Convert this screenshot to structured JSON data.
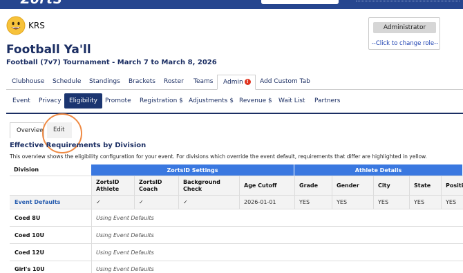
{
  "header": {
    "logo_text": "ZortS"
  },
  "org": {
    "avatar_icon": "smiley-face-icon",
    "name": "KRS"
  },
  "role": {
    "button_label": "Administrator",
    "change_link": "--Click to change role--"
  },
  "event": {
    "title": "Football Ya'll",
    "subtitle": "Football (7v7) Tournament  -  March 7 to March 8, 2026"
  },
  "main_tabs": [
    "Clubhouse",
    "Schedule",
    "Standings",
    "Brackets",
    "Roster",
    "Teams",
    "Admin",
    "Add Custom Tab"
  ],
  "admin_alert": "!",
  "admin_tabs": [
    "Event",
    "Privacy",
    "Eligibility",
    "Promote",
    "Registration $",
    "Adjustments $",
    "Revenue $",
    "Wait List",
    "Partners"
  ],
  "sub_tabs": [
    "Overview",
    "Edit"
  ],
  "section": {
    "title": "Effective Requirements by Division",
    "description": "This overview shows the eligibility configuration for your event. For divisions which override the event default, requirements that differ are highlighted in yellow."
  },
  "table": {
    "division_header": "Division",
    "group_headers": [
      "ZortsID Settings",
      "Athlete Details"
    ],
    "columns": [
      "ZortsID Athlete",
      "ZortsID Coach",
      "Background Check",
      "Age Cutoff",
      "Grade",
      "Gender",
      "City",
      "State",
      "Position"
    ],
    "defaults_row": {
      "label": "Event Defaults",
      "values": [
        "✓",
        "✓",
        "✓",
        "2026-01-01",
        "YES",
        "YES",
        "YES",
        "YES",
        "YES"
      ]
    },
    "divisions": [
      {
        "label": "Coed 8U",
        "note": "Using Event Defaults"
      },
      {
        "label": "Coed 10U",
        "note": "Using Event Defaults"
      },
      {
        "label": "Coed 12U",
        "note": "Using Event Defaults"
      },
      {
        "label": "Girl's 10U",
        "note": "Using Event Defaults"
      }
    ]
  },
  "colors": {
    "brand_navy": "#1b2e63",
    "header_blue": "#3a78e0",
    "highlight_ring": "#ef8a43"
  }
}
